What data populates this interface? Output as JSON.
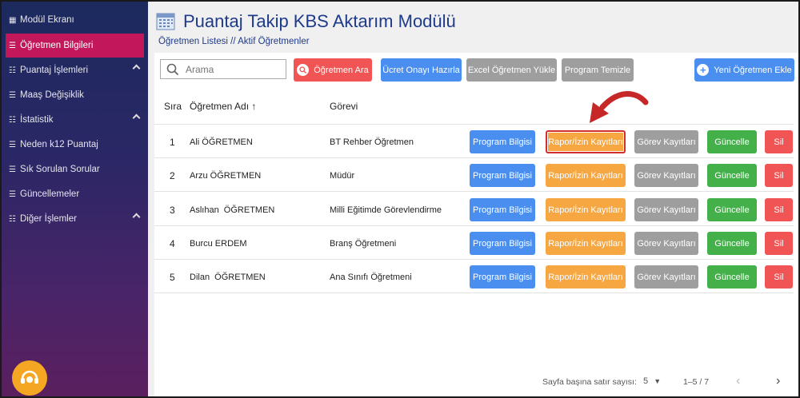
{
  "sidebar": {
    "items": [
      {
        "label": "Modül Ekranı",
        "icon": "grid-icon",
        "active": false,
        "expandable": false
      },
      {
        "label": "Öğretmen Bilgileri",
        "icon": "list-icon",
        "active": true,
        "expandable": false
      },
      {
        "label": "Puantaj İşlemleri",
        "icon": "list-sub-icon",
        "active": false,
        "expandable": true
      },
      {
        "label": "Maaş Değişiklik",
        "icon": "list-icon",
        "active": false,
        "expandable": false
      },
      {
        "label": "İstatistik",
        "icon": "list-sub-icon",
        "active": false,
        "expandable": true
      },
      {
        "label": "Neden k12 Puantaj",
        "icon": "list-icon",
        "active": false,
        "expandable": false
      },
      {
        "label": "Sık Sorulan Sorular",
        "icon": "list-icon",
        "active": false,
        "expandable": false
      },
      {
        "label": "Güncellemeler",
        "icon": "list-icon",
        "active": false,
        "expandable": false
      },
      {
        "label": "Diğer İşlemler",
        "icon": "list-sub-icon",
        "active": false,
        "expandable": true
      }
    ]
  },
  "header": {
    "title": "Puantaj Takip KBS Aktarım Modülü",
    "breadcrumb": "Öğretmen Listesi // Aktif Öğretmenler"
  },
  "toolbar": {
    "search_placeholder": "Arama",
    "search_button": "Öğretmen Ara",
    "salary_button": "Ücret Onayı Hazırla",
    "excel_button": "Excel Öğretmen Yükle",
    "clear_button": "Program Temizle",
    "add_button": "Yeni Öğretmen Ekle"
  },
  "table": {
    "columns": {
      "no": "Sıra",
      "name": "Öğretmen Adı",
      "role": "Görevi"
    },
    "rows": [
      {
        "no": "1",
        "name": "Ali ÖĞRETMEN",
        "role": "BT Rehber Öğretmen"
      },
      {
        "no": "2",
        "name": "Arzu ÖĞRETMEN",
        "role": "Müdür"
      },
      {
        "no": "3",
        "name": "Aslıhan  ÖĞRETMEN",
        "role": "Milli Eğitimde Görevlendirme"
      },
      {
        "no": "4",
        "name": "Burcu ERDEM",
        "role": "Branş Öğretmeni"
      },
      {
        "no": "5",
        "name": "Dilan  ÖĞRETMEN",
        "role": "Ana Sınıfı Öğretmeni"
      }
    ],
    "row_actions": {
      "program": "Program Bilgisi",
      "report": "Rapor/İzin Kayıtları",
      "duty": "Görev Kayıtları",
      "update": "Güncelle",
      "delete": "Sil"
    }
  },
  "pagination": {
    "rows_per_page_label": "Sayfa başına satır sayısı:",
    "rows_per_page": "5",
    "range": "1–5 / 7"
  },
  "colors": {
    "accent": "#c2185b",
    "title": "#1e3a8a",
    "red": "#f05454",
    "blue": "#4a8ef0",
    "gray": "#9e9e9e",
    "orange": "#f7a742",
    "green": "#43b04a",
    "highlight": "#d32f2f"
  }
}
